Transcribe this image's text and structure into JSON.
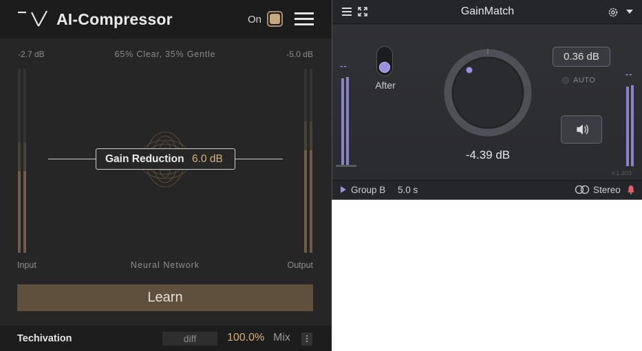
{
  "ai_compressor": {
    "title": "AI-Compressor",
    "power": {
      "label": "On",
      "state": "on"
    },
    "input_db": "-2.7 dB",
    "mode": "65% Clear, 35% Gentle",
    "output_db": "-5.0 dB",
    "gain_reduction": {
      "label": "Gain Reduction",
      "value": "6.0 dB"
    },
    "labels": {
      "input": "Input",
      "network": "Neural Network",
      "output": "Output"
    },
    "learn_label": "Learn",
    "footer": {
      "brand": "Techivation",
      "diff": "diff",
      "mix_value": "100.0%",
      "mix_label": "Mix"
    },
    "accent_color": "#d6b478",
    "button_color": "#5f4f3d"
  },
  "gainmatch": {
    "title": "GainMatch",
    "toggle_label": "After",
    "knob_value": "-4.39 dB",
    "offset_value": "0.36 dB",
    "auto_label": "AUTO",
    "version": "v.1.403",
    "bottom": {
      "group": "Group B",
      "time": "5.0 s",
      "mode": "Stereo"
    },
    "accent_color": "#9a8fe0",
    "meter_dash": "--",
    "icons": [
      "hamburger-icon",
      "expand-icon",
      "gear-icon",
      "dropdown-caret-icon",
      "speaker-icon",
      "play-icon",
      "stereo-rings-icon",
      "bell-icon"
    ]
  }
}
